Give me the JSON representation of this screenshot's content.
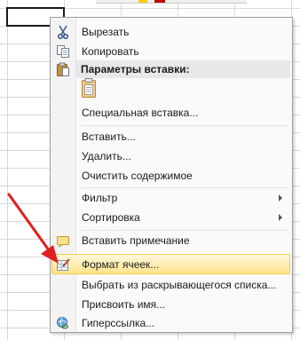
{
  "menu": {
    "items": [
      {
        "label": "Вырезать",
        "icon": "scissors-icon"
      },
      {
        "label": "Копировать",
        "icon": "copy-icon"
      },
      {
        "label": "Параметры вставки:",
        "icon": "paste-icon"
      },
      {
        "label": "Специальная вставка..."
      },
      {
        "label": "Вставить..."
      },
      {
        "label": "Удалить..."
      },
      {
        "label": "Очистить содержимое"
      },
      {
        "label": "Фильтр",
        "submenu": true
      },
      {
        "label": "Сортировка",
        "submenu": true
      },
      {
        "label": "Вставить примечание",
        "icon": "comment-icon"
      },
      {
        "label": "Формат ячеек...",
        "icon": "format-cells-icon",
        "highlighted": true
      },
      {
        "label": "Выбрать из раскрывающегося списка..."
      },
      {
        "label": "Присвоить имя..."
      },
      {
        "label": "Гиперссылка...",
        "icon": "hyperlink-icon"
      }
    ],
    "paste_option_icon": "paste-values-icon"
  },
  "colors": {
    "highlight": "#ffe38b",
    "annotation_arrow": "#e02020"
  }
}
